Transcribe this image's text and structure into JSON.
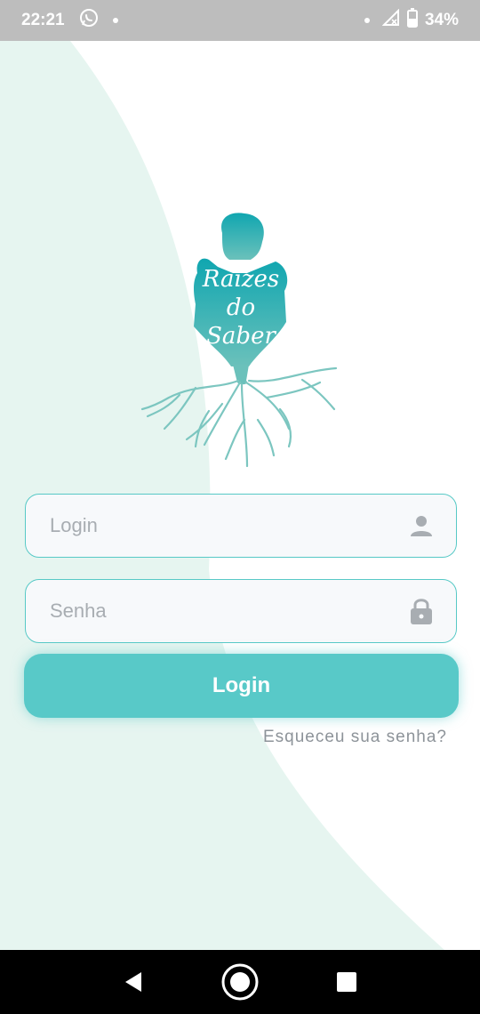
{
  "status_bar": {
    "time": "22:21",
    "battery": "34%",
    "icons": [
      "whatsapp-icon",
      "notification-dot-icon",
      "dot-icon",
      "no-signal-icon",
      "battery-icon"
    ]
  },
  "logo": {
    "line1": "Raizes",
    "line2": "do",
    "line3": "Saber"
  },
  "form": {
    "login_placeholder": "Login",
    "senha_placeholder": "Senha",
    "login_value": "",
    "senha_value": "",
    "login_icon": "person-icon",
    "senha_icon": "lock-icon",
    "submit_label": "Login",
    "forgot_label": "Esqueceu sua senha?"
  },
  "nav_bar": {
    "buttons": [
      "back-icon",
      "home-icon",
      "recents-icon"
    ]
  },
  "colors": {
    "accent": "#58c9c8",
    "background_curve": "#e6f5f0",
    "status_bar": "#bdbdbd",
    "placeholder": "#a8adb2"
  }
}
